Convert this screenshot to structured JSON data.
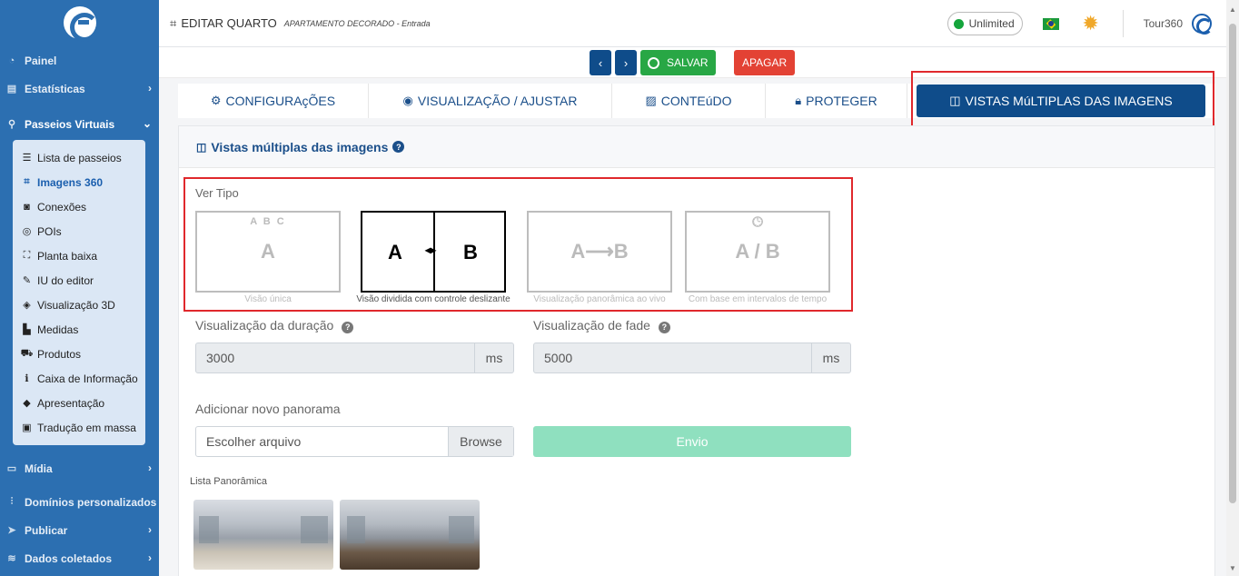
{
  "sidebar": {
    "items_top": [
      {
        "label": "Painel",
        "icon": "gauge-icon"
      },
      {
        "label": "Estatísticas",
        "icon": "chart-icon"
      },
      {
        "label": "Passeios Virtuais",
        "icon": "route-icon"
      }
    ],
    "submenu": [
      {
        "label": "Lista de passeios",
        "icon": "list-icon"
      },
      {
        "label": "Imagens 360",
        "icon": "frame-icon"
      },
      {
        "label": "Conexões",
        "icon": "link-icon"
      },
      {
        "label": "POIs",
        "icon": "target-icon"
      },
      {
        "label": "Planta baixa",
        "icon": "map-icon"
      },
      {
        "label": "IU do editor",
        "icon": "tools-icon"
      },
      {
        "label": "Visualização 3D",
        "icon": "cube-icon"
      },
      {
        "label": "Medidas",
        "icon": "ruler-icon"
      },
      {
        "label": "Produtos",
        "icon": "cart-icon"
      },
      {
        "label": "Caixa de Informação",
        "icon": "info-icon"
      },
      {
        "label": "Apresentação",
        "icon": "diamond-icon"
      },
      {
        "label": "Tradução em massa",
        "icon": "translate-icon"
      }
    ],
    "items_bottom": [
      {
        "label": "Mídia",
        "icon": "monitor-icon"
      },
      {
        "label": "Domínios personalizados",
        "icon": "sitemap-icon"
      },
      {
        "label": "Publicar",
        "icon": "send-icon"
      },
      {
        "label": "Dados coletados",
        "icon": "layers-icon"
      }
    ]
  },
  "header": {
    "title": "EDITAR QUARTO",
    "subtitle": "APARTAMENTO DECORADO - Entrada",
    "plan": "Unlimited",
    "user": "Tour360"
  },
  "actions": {
    "prev": "‹",
    "next": "›",
    "save": "SALVAR",
    "delete": "APAGAR"
  },
  "tabs": [
    {
      "label": "CONFIGURAçÕES",
      "icon": "cogs-icon"
    },
    {
      "label": "VISUALIZAÇÃO / AJUSTAR",
      "icon": "eye-icon"
    },
    {
      "label": "CONTEúDO",
      "icon": "images-icon"
    },
    {
      "label": "PROTEGER",
      "icon": "lock-icon"
    },
    {
      "label": "VISTAS MúLTIPLAS DAS IMAGENS",
      "icon": "columns-icon"
    }
  ],
  "panel": {
    "title": "Vistas múltiplas das imagens",
    "view_type_label": "Ver Tipo",
    "view_types": [
      {
        "caption": "Visão única",
        "text": "A",
        "markers": "A B C"
      },
      {
        "caption": "Visão dividida com controle deslizante",
        "left": "A",
        "right": "B",
        "arrows": "◂▸"
      },
      {
        "caption": "Visualização panorâmica ao vivo",
        "text": "A⟶B"
      },
      {
        "caption": "Com base em intervalos de tempo",
        "text": "A / B"
      }
    ],
    "duration_label": "Visualização da duração",
    "duration_value": "3000",
    "duration_unit": "ms",
    "fade_label": "Visualização de fade",
    "fade_value": "5000",
    "fade_unit": "ms",
    "add_label": "Adicionar novo panorama",
    "file_placeholder": "Escolher arquivo",
    "browse": "Browse",
    "send": "Envio",
    "list_label": "Lista Panorâmica"
  }
}
